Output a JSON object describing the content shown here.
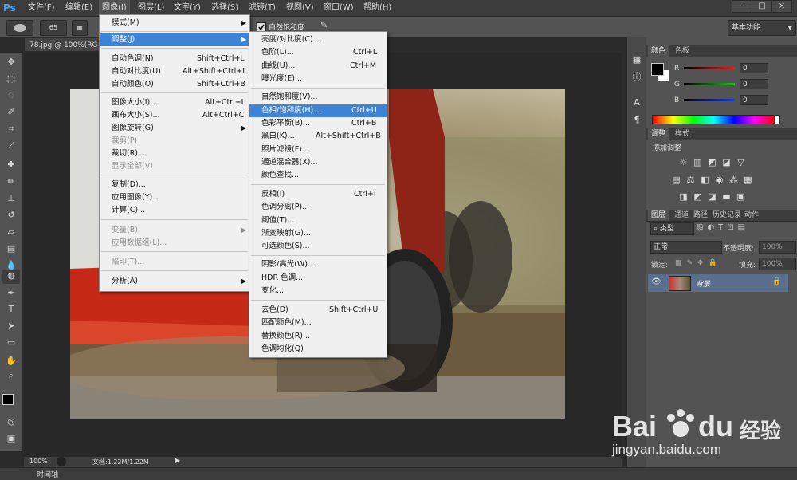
{
  "app": {
    "logo": "Ps",
    "menubar": [
      "文件(F)",
      "编辑(E)",
      "图像(I)",
      "图层(L)",
      "文字(Y)",
      "选择(S)",
      "滤镜(T)",
      "视图(V)",
      "窗口(W)",
      "帮助(H)"
    ],
    "window_controls": [
      "–",
      "□",
      "×"
    ]
  },
  "options_bar": {
    "brush_size": "65",
    "vibrance_checkbox_label": "自然饱和度",
    "workspace": "基本功能"
  },
  "document": {
    "tab_title": "78.jpg @ 100%(RG",
    "zoom": "100%",
    "doc_size": "文档:1.22M/1.22M"
  },
  "timeline_label": "时间轴",
  "image_menu": {
    "items": [
      {
        "label": "模式(M)",
        "shortcut": "",
        "submenu": true,
        "disabled": false
      },
      {
        "label": "调整(J)",
        "shortcut": "",
        "submenu": true,
        "disabled": false,
        "highlight": true
      },
      {
        "label": "自动色调(N)",
        "shortcut": "Shift+Ctrl+L",
        "submenu": false,
        "disabled": false
      },
      {
        "label": "自动对比度(U)",
        "shortcut": "Alt+Shift+Ctrl+L",
        "submenu": false,
        "disabled": false
      },
      {
        "label": "自动颜色(O)",
        "shortcut": "Shift+Ctrl+B",
        "submenu": false,
        "disabled": false
      },
      {
        "label": "图像大小(I)...",
        "shortcut": "Alt+Ctrl+I",
        "submenu": false,
        "disabled": false
      },
      {
        "label": "画布大小(S)...",
        "shortcut": "Alt+Ctrl+C",
        "submenu": false,
        "disabled": false
      },
      {
        "label": "图像旋转(G)",
        "shortcut": "",
        "submenu": true,
        "disabled": false
      },
      {
        "label": "裁剪(P)",
        "shortcut": "",
        "submenu": false,
        "disabled": true
      },
      {
        "label": "裁切(R)...",
        "shortcut": "",
        "submenu": false,
        "disabled": false
      },
      {
        "label": "显示全部(V)",
        "shortcut": "",
        "submenu": false,
        "disabled": true
      },
      {
        "label": "复制(D)...",
        "shortcut": "",
        "submenu": false,
        "disabled": false
      },
      {
        "label": "应用图像(Y)...",
        "shortcut": "",
        "submenu": false,
        "disabled": false
      },
      {
        "label": "计算(C)...",
        "shortcut": "",
        "submenu": false,
        "disabled": false
      },
      {
        "label": "变量(B)",
        "shortcut": "",
        "submenu": true,
        "disabled": true
      },
      {
        "label": "应用数据组(L)...",
        "shortcut": "",
        "submenu": false,
        "disabled": true
      },
      {
        "label": "陷印(T)...",
        "shortcut": "",
        "submenu": false,
        "disabled": true
      },
      {
        "label": "分析(A)",
        "shortcut": "",
        "submenu": true,
        "disabled": false
      }
    ]
  },
  "adjust_menu": {
    "items": [
      {
        "label": "亮度/对比度(C)...",
        "shortcut": ""
      },
      {
        "label": "色阶(L)...",
        "shortcut": "Ctrl+L"
      },
      {
        "label": "曲线(U)...",
        "shortcut": "Ctrl+M"
      },
      {
        "label": "曝光度(E)...",
        "shortcut": ""
      },
      {
        "label": "自然饱和度(V)...",
        "shortcut": ""
      },
      {
        "label": "色相/饱和度(H)...",
        "shortcut": "Ctrl+U",
        "highlight": true
      },
      {
        "label": "色彩平衡(B)...",
        "shortcut": "Ctrl+B"
      },
      {
        "label": "黑白(K)...",
        "shortcut": "Alt+Shift+Ctrl+B"
      },
      {
        "label": "照片滤镜(F)...",
        "shortcut": ""
      },
      {
        "label": "通道混合器(X)...",
        "shortcut": ""
      },
      {
        "label": "颜色查找...",
        "shortcut": ""
      },
      {
        "label": "反相(I)",
        "shortcut": "Ctrl+I"
      },
      {
        "label": "色调分离(P)...",
        "shortcut": ""
      },
      {
        "label": "阈值(T)...",
        "shortcut": ""
      },
      {
        "label": "渐变映射(G)...",
        "shortcut": ""
      },
      {
        "label": "可选颜色(S)...",
        "shortcut": ""
      },
      {
        "label": "阴影/高光(W)...",
        "shortcut": ""
      },
      {
        "label": "HDR 色调...",
        "shortcut": ""
      },
      {
        "label": "变化...",
        "shortcut": ""
      },
      {
        "label": "去色(D)",
        "shortcut": "Shift+Ctrl+U"
      },
      {
        "label": "匹配颜色(M)...",
        "shortcut": ""
      },
      {
        "label": "替换颜色(R)...",
        "shortcut": ""
      },
      {
        "label": "色调均化(Q)",
        "shortcut": ""
      }
    ]
  },
  "color_panel": {
    "tabs": [
      "颜色",
      "色板"
    ],
    "channels": [
      {
        "label": "R",
        "value": "0",
        "color": "#e02020"
      },
      {
        "label": "G",
        "value": "0",
        "color": "#20c020"
      },
      {
        "label": "B",
        "value": "0",
        "color": "#2040e0"
      }
    ]
  },
  "adjust_panel": {
    "tabs": [
      "调整",
      "样式"
    ],
    "heading": "添加调整"
  },
  "layers_panel": {
    "tabs": [
      "图层",
      "通道",
      "路径",
      "历史记录",
      "动作"
    ],
    "search": "类型",
    "blend_mode": "正常",
    "opacity_label": "不透明度:",
    "opacity_value": "100%",
    "lock_label": "锁定:",
    "fill_label": "填充:",
    "fill_value": "100%",
    "layer_name": "背景"
  },
  "watermark": {
    "brand": "Bai",
    "brand2": "du",
    "cn": "经验",
    "url": "jingyan.baidu.com"
  },
  "colors": {
    "menu_highlight": "#3d84d6",
    "accent_blue": "#4aa3ff"
  }
}
